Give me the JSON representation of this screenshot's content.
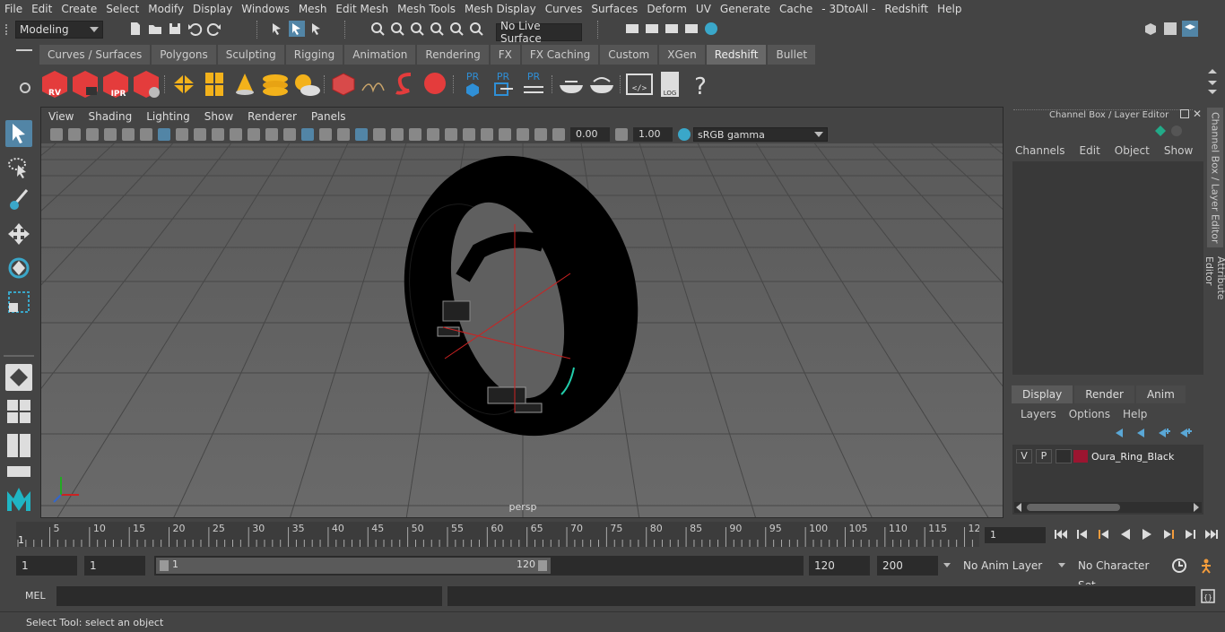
{
  "menu": [
    "File",
    "Edit",
    "Create",
    "Select",
    "Modify",
    "Display",
    "Windows",
    "Mesh",
    "Edit Mesh",
    "Mesh Tools",
    "Mesh Display",
    "Curves",
    "Surfaces",
    "Deform",
    "UV",
    "Generate",
    "Cache",
    "- 3DtoAll -",
    "Redshift",
    "Help"
  ],
  "status": {
    "mode": "Modeling",
    "live_surface": "No Live Surface"
  },
  "shelf_tabs": [
    "Curves / Surfaces",
    "Polygons",
    "Sculpting",
    "Rigging",
    "Animation",
    "Rendering",
    "FX",
    "FX Caching",
    "Custom",
    "XGen",
    "Redshift",
    "Bullet"
  ],
  "active_shelf_tab": "Redshift",
  "shelf_labels": {
    "rv": "RV",
    "ipr": "IPR",
    "pr": "PR",
    "log": "LOG",
    "help": "?"
  },
  "viewport": {
    "menu": [
      "View",
      "Shading",
      "Lighting",
      "Show",
      "Renderer",
      "Panels"
    ],
    "exposure": "0.00",
    "gamma": "1.00",
    "color_space": "sRGB gamma",
    "camera_label": "persp"
  },
  "channel_box": {
    "title": "Channel Box / Layer Editor",
    "menu": [
      "Channels",
      "Edit",
      "Object",
      "Show"
    ]
  },
  "layer_editor": {
    "tabs": [
      "Display",
      "Render",
      "Anim"
    ],
    "active_tab": "Display",
    "menu": [
      "Layers",
      "Options",
      "Help"
    ],
    "layers": [
      {
        "v": "V",
        "p": "P",
        "name": "Oura_Ring_Black",
        "color": "#9b1530"
      }
    ]
  },
  "side_tabs": [
    "Channel Box / Layer Editor",
    "Attribute Editor"
  ],
  "timeline": {
    "ticks": [
      "5",
      "10",
      "15",
      "20",
      "25",
      "30",
      "35",
      "40",
      "45",
      "50",
      "55",
      "60",
      "65",
      "70",
      "75",
      "80",
      "85",
      "90",
      "95",
      "100",
      "105",
      "110",
      "115",
      "12"
    ],
    "start_marker": "1",
    "current_frame": "1"
  },
  "range": {
    "start": "1",
    "playback_start": "1",
    "slider_start": "1",
    "slider_end": "120",
    "playback_end": "120",
    "end": "200",
    "anim_layer": "No Anim Layer",
    "char_set": "No Character Set"
  },
  "mel_label": "MEL",
  "help_text": "Select Tool: select an object",
  "colors": {
    "accent": "#5285a6",
    "redshift": "#e43c3c",
    "yellow": "#f3b21b",
    "pr_blue": "#2f8fd6"
  }
}
